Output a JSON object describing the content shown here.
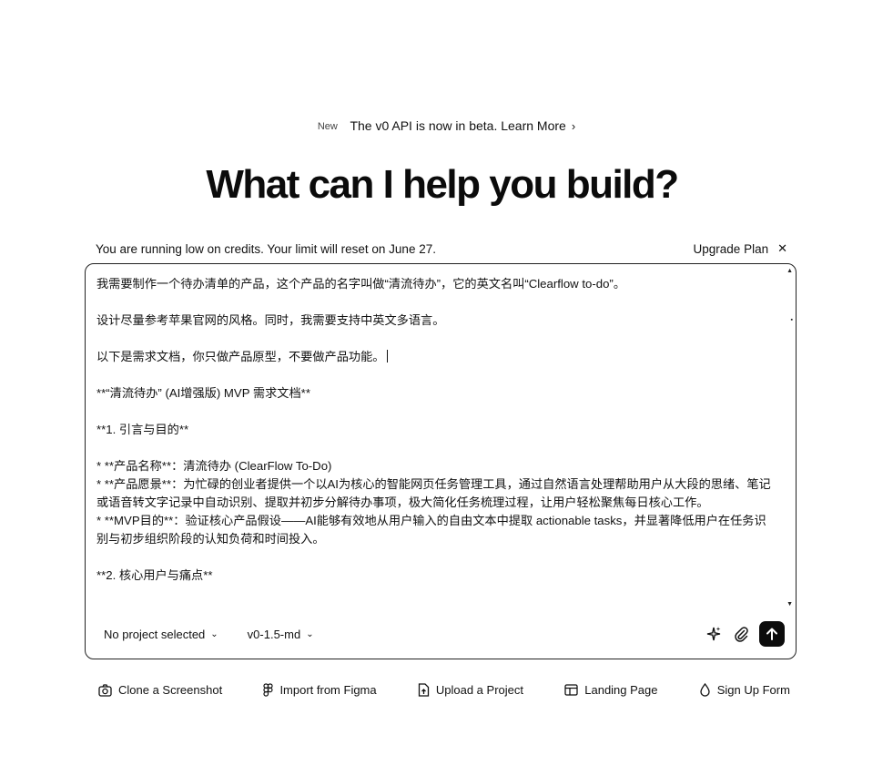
{
  "announcement": {
    "badge": "New",
    "text": "The v0 API is now in beta.",
    "link": "Learn More"
  },
  "headline": "What can I help you build?",
  "credits": {
    "message": "You are running low on credits. Your limit will reset on June 27.",
    "upgrade_label": "Upgrade Plan"
  },
  "composer": {
    "lines": [
      "我需要制作一个待办清单的产品，这个产品的名字叫做“清流待办”，它的英文名叫“Clearflow to-do”。",
      "",
      "设计尽量参考苹果官网的风格。同时，我需要支持中英文多语言。",
      "",
      "以下是需求文档，你只做产品原型，不要做产品功能。",
      "",
      "**“清流待办” (AI增强版) MVP 需求文档**",
      "",
      "**1. 引言与目的**",
      "",
      "* **产品名称**：清流待办 (ClearFlow To-Do)",
      "* **产品愿景**：为忙碌的创业者提供一个以AI为核心的智能网页任务管理工具，通过自然语言处理帮助用户从大段的思绪、笔记或语音转文字记录中自动识别、提取并初步分解待办事项，极大简化任务梳理过程，让用户轻松聚焦每日核心工作。",
      "* **MVP目的**：验证核心产品假设——AI能够有效地从用户输入的自由文本中提取 actionable tasks，并显著降低用户在任务识别与初步组织阶段的认知负荷和时间投入。",
      "",
      "**2. 核心用户与痛点**"
    ],
    "project_label": "No project selected",
    "model_label": "v0-1.5-md"
  },
  "suggestions": [
    {
      "label": "Clone a Screenshot",
      "icon": "camera-icon"
    },
    {
      "label": "Import from Figma",
      "icon": "figma-icon"
    },
    {
      "label": "Upload a Project",
      "icon": "file-upload-icon"
    },
    {
      "label": "Landing Page",
      "icon": "layout-icon"
    },
    {
      "label": "Sign Up Form",
      "icon": "droplet-icon"
    }
  ]
}
